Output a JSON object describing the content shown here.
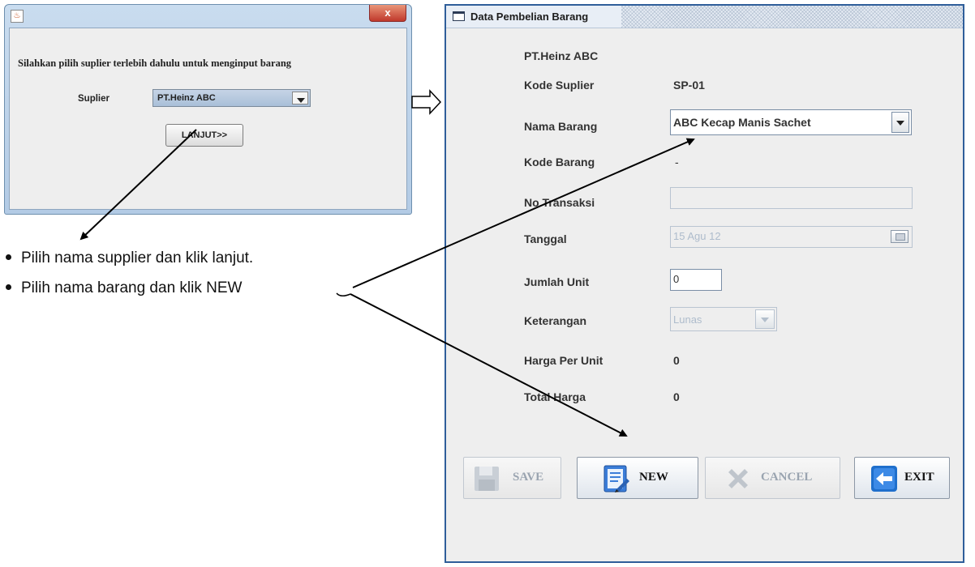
{
  "dialog_supplier": {
    "close_label": "x",
    "message": "Silahkan pilih suplier terlebih dahulu untuk menginput barang",
    "supplier_label": "Suplier",
    "supplier_value": "PT.Heinz ABC",
    "next_button": "LANJUT>>"
  },
  "instructions": [
    "Pilih nama supplier dan klik lanjut.",
    "Pilih nama barang dan klik NEW"
  ],
  "window_purchase": {
    "title": "Data Pembelian Barang",
    "supplier_name": "PT.Heinz ABC",
    "fields": {
      "kode_suplier_label": "Kode Suplier",
      "kode_suplier_value": "SP-01",
      "nama_barang_label": "Nama Barang",
      "nama_barang_value": "ABC Kecap Manis Sachet",
      "kode_barang_label": "Kode Barang",
      "kode_barang_value": "-",
      "no_transaksi_label": "No Transaksi",
      "no_transaksi_value": "",
      "tanggal_label": "Tanggal",
      "tanggal_value": "15 Agu 12",
      "jumlah_unit_label": "Jumlah Unit",
      "jumlah_unit_value": "0",
      "keterangan_label": "Keterangan",
      "keterangan_value": "Lunas",
      "harga_per_unit_label": "Harga Per Unit",
      "harga_per_unit_value": "0",
      "total_harga_label": "Total Harga",
      "total_harga_value": "0"
    },
    "buttons": {
      "save": "SAVE",
      "new": "NEW",
      "cancel": "CANCEL",
      "exit": "EXIT"
    }
  },
  "colors": {
    "window_border": "#2f5e9a",
    "panel_bg": "#eeeeee",
    "disabled_text": "#aebccc",
    "exit_icon": "#1f6fcc",
    "new_icon": "#3b7dd8"
  },
  "icons": [
    "java-icon",
    "close-icon",
    "window-icon",
    "calendar-icon",
    "save-icon",
    "new-icon",
    "cancel-icon",
    "exit-icon",
    "dropdown-arrow-icon"
  ]
}
